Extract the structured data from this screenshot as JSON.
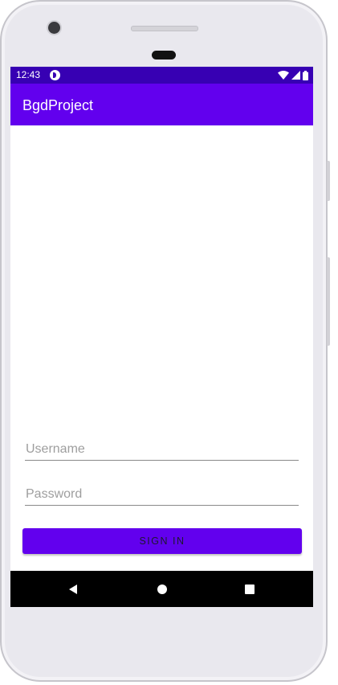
{
  "status_bar": {
    "time": "12:43",
    "icons": [
      "notification-icon",
      "wifi-icon",
      "signal-icon",
      "battery-icon"
    ]
  },
  "app_bar": {
    "title": "BgdProject"
  },
  "form": {
    "username_placeholder": "Username",
    "username_value": "",
    "password_placeholder": "Password",
    "password_value": "",
    "signin_label": "SIGN IN"
  },
  "nav_bar": {
    "buttons": [
      "back-icon",
      "home-icon",
      "recents-icon"
    ]
  },
  "colors": {
    "status_bar": "#3700b3",
    "app_bar": "#6200ee",
    "button": "#6200ee",
    "nav_bar": "#000000"
  }
}
